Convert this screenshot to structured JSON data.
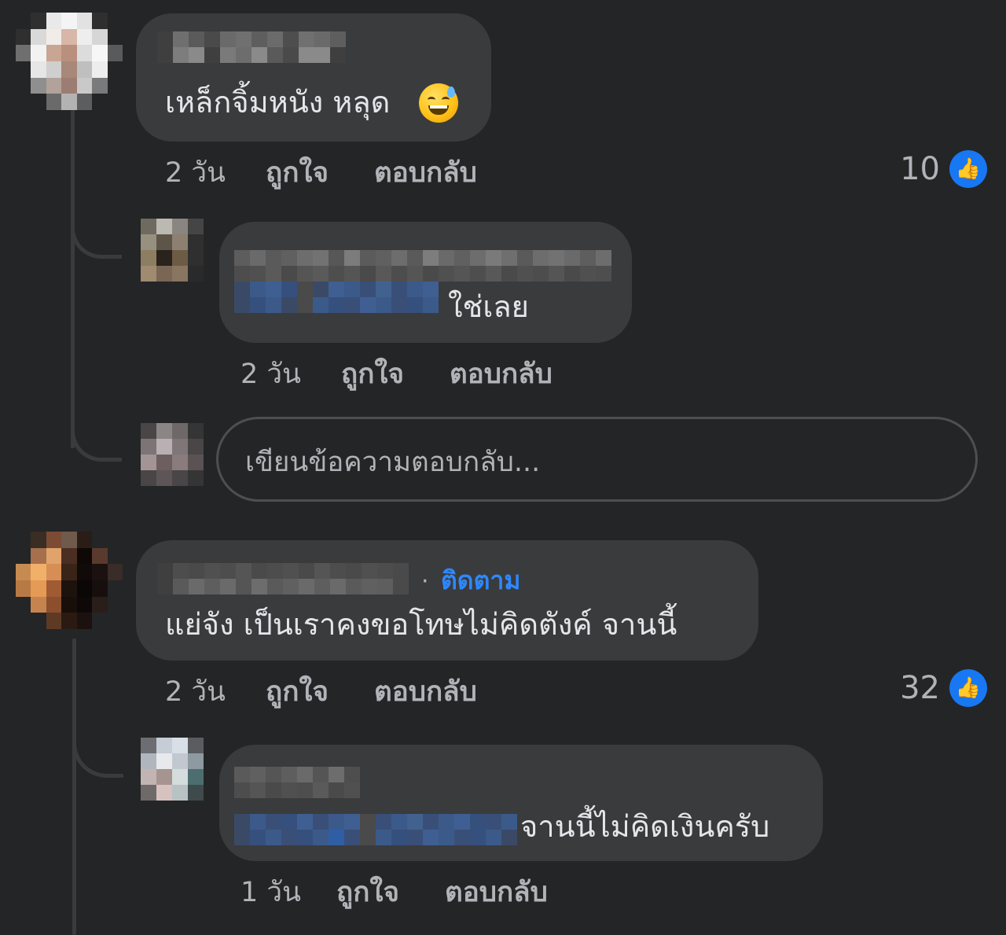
{
  "comments": [
    {
      "text": "เหล็กจิ้มหนัง หลุด",
      "emoji": "grinning-face-with-sweat",
      "time": "2 วัน",
      "like_label": "ถูกใจ",
      "reply_label": "ตอบกลับ",
      "like_count": "10",
      "replies": [
        {
          "text": "ใช่เลย",
          "time": "2 วัน",
          "like_label": "ถูกใจ",
          "reply_label": "ตอบกลับ"
        }
      ],
      "reply_input": {
        "placeholder": "เขียนข้อความตอบกลับ..."
      }
    },
    {
      "follow_label": "ติดตาม",
      "text": "แย่จัง เป็นเราคงขอโทษไม่คิดตังค์ จานนี้",
      "time": "2 วัน",
      "like_label": "ถูกใจ",
      "reply_label": "ตอบกลับ",
      "like_count": "32",
      "replies": [
        {
          "text": "จานนี้ไม่คิดเงินครับ",
          "time": "1 วัน",
          "like_label": "ถูกใจ",
          "reply_label": "ตอบกลับ"
        }
      ]
    }
  ],
  "colors": {
    "background": "#242526",
    "bubble": "#3a3b3c",
    "text": "#e4e6eb",
    "muted": "#b0b3b8",
    "link": "#2d88ff",
    "like_blue": "#1877f2"
  },
  "icons": {
    "like_reaction": "thumbs-up-icon",
    "emoji": "grinning-face-with-sweat"
  }
}
